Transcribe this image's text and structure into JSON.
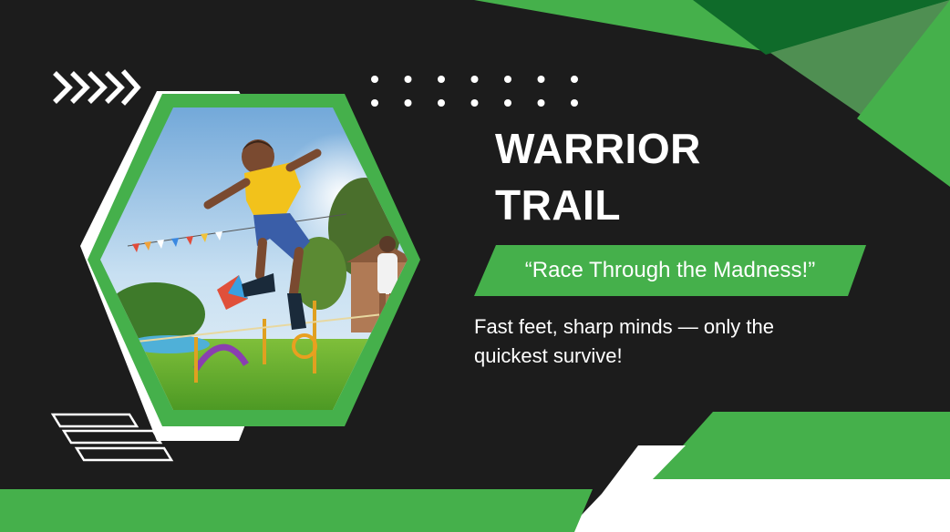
{
  "title": {
    "line1": "WARRIOR",
    "line2": "TRAIL"
  },
  "slogan": "“Race Through the Madness!”",
  "tagline": "Fast feet, sharp minds — only the quickest survive!",
  "photo": {
    "subject": "boy jumping over obstacle course hurdle in a backyard, girl in background, bunting flags"
  },
  "colors": {
    "background": "#1c1c1c",
    "accent_green": "#45b04b",
    "dark_green": "#0f6b2a",
    "muted_green": "#4f8f52",
    "white": "#ffffff"
  },
  "icons": [
    "chevron-arrows-icon",
    "dot-grid-icon",
    "parallelogram-lines-icon"
  ]
}
